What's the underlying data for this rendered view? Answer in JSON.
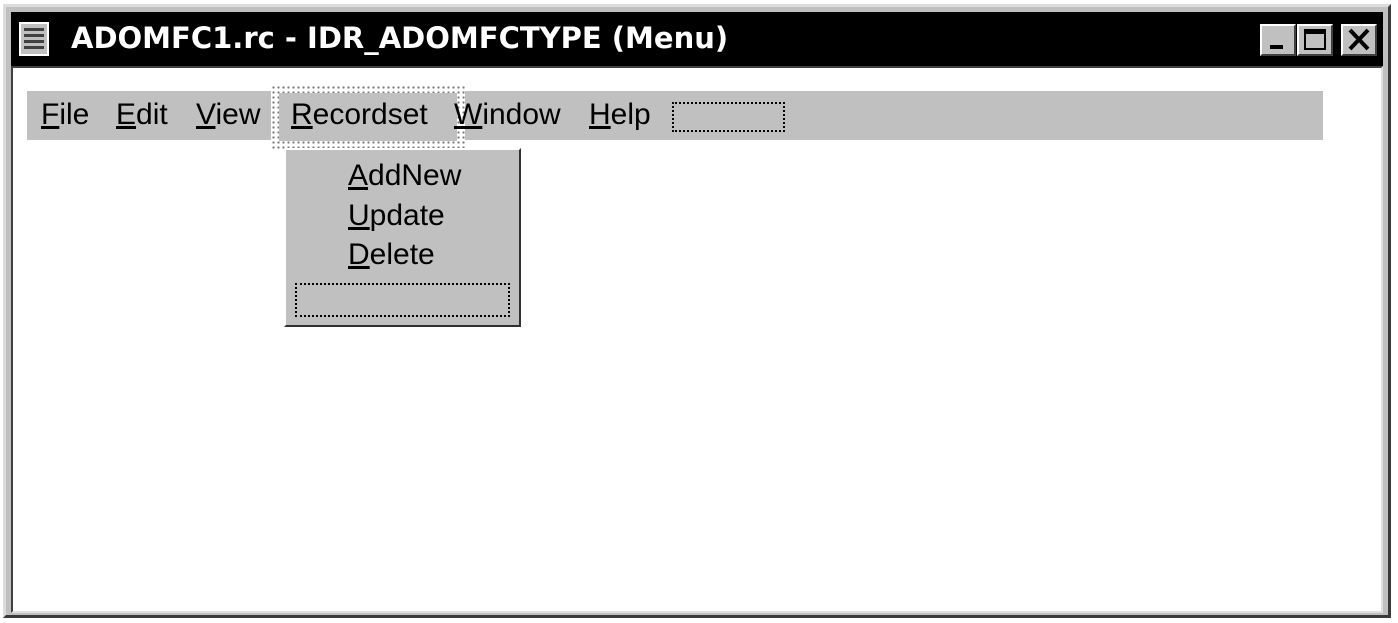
{
  "window": {
    "title": "ADOMFC1.rc - IDR_ADOMFCTYPE (Menu)"
  },
  "titlebar_buttons": {
    "minimize_icon": "minimize-icon",
    "maximize_icon": "maximize-icon",
    "close_icon": "close-icon"
  },
  "menubar": {
    "items": [
      {
        "label_pre": "",
        "accel": "F",
        "label_post": "ile"
      },
      {
        "label_pre": "",
        "accel": "E",
        "label_post": "dit"
      },
      {
        "label_pre": "",
        "accel": "V",
        "label_post": "iew"
      },
      {
        "label_pre": "",
        "accel": "R",
        "label_post": "ecordset"
      },
      {
        "label_pre": "",
        "accel": "W",
        "label_post": "indow"
      },
      {
        "label_pre": "",
        "accel": "H",
        "label_post": "elp"
      }
    ]
  },
  "dropdown": {
    "items": [
      {
        "label_pre": "",
        "accel": "A",
        "label_post": "ddNew"
      },
      {
        "label_pre": "",
        "accel": "U",
        "label_post": "pdate"
      },
      {
        "label_pre": "",
        "accel": "D",
        "label_post": "elete"
      }
    ]
  },
  "colors": {
    "titlebar": "#000000",
    "face": "#c0c0c0",
    "client": "#ffffff"
  }
}
